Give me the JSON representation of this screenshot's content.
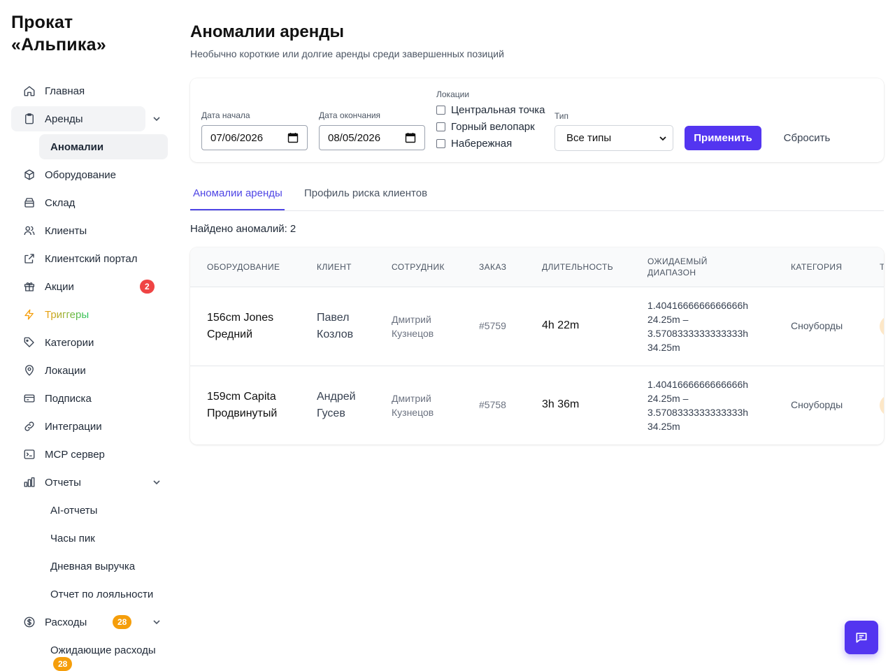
{
  "app": {
    "brand_line1": "Прокат",
    "brand_line2": "«Альпика»"
  },
  "sidebar": {
    "items": [
      {
        "label": "Главная",
        "icon": "home-icon"
      },
      {
        "label": "Аренды",
        "icon": "clipboard-icon"
      },
      {
        "label": "Аномалии"
      },
      {
        "label": "Оборудование",
        "icon": "box-icon"
      },
      {
        "label": "Склад",
        "icon": "warehouse-icon"
      },
      {
        "label": "Клиенты",
        "icon": "users-icon"
      },
      {
        "label": "Клиентский портал",
        "icon": "external-link-icon"
      },
      {
        "label": "Акции",
        "icon": "gift-icon",
        "badge": "2"
      },
      {
        "label": "Триггеры",
        "icon": "lightning-icon"
      },
      {
        "label": "Категории",
        "icon": "tag-icon"
      },
      {
        "label": "Локации",
        "icon": "map-pin-icon"
      },
      {
        "label": "Подписка",
        "icon": "credit-card-icon"
      },
      {
        "label": "Интеграции",
        "icon": "link-icon"
      },
      {
        "label": "MCP сервер",
        "icon": "terminal-icon"
      },
      {
        "label": "Отчеты",
        "icon": "bar-chart-icon"
      },
      {
        "label": "AI-отчеты"
      },
      {
        "label": "Часы пик"
      },
      {
        "label": "Дневная выручка"
      },
      {
        "label": "Отчет по лояльности"
      },
      {
        "label": "Расходы",
        "icon": "dollar-circle-icon",
        "badge": "28"
      },
      {
        "label": "Ожидающие расходы",
        "badge": "28"
      }
    ]
  },
  "page": {
    "title": "Аномалии аренды",
    "subtitle": "Необычно короткие или долгие аренды среди завершенных позиций"
  },
  "filters": {
    "start_label": "Дата начала",
    "start_value": "07/06/2026",
    "end_label": "Дата окончания",
    "end_value": "08/05/2026",
    "locations_label": "Локации",
    "locations": [
      "Центральная точка",
      "Горный велопарк",
      "Набережная"
    ],
    "type_label": "Тип",
    "type_value": "Все типы",
    "apply": "Применить",
    "reset": "Сбросить"
  },
  "tabs": [
    "Аномалии аренды",
    "Профиль риска клиентов"
  ],
  "found": "Найдено аномалий: 2",
  "table": {
    "headers": [
      "ОБОРУДОВАНИЕ",
      "КЛИЕНТ",
      "СОТРУДНИК",
      "ЗАКАЗ",
      "ДЛИТЕЛЬНОСТЬ",
      "ОЖИДАЕМЫЙ ДИАПАЗОН",
      "КАТЕГОРИЯ",
      "Т"
    ],
    "rows": [
      {
        "equipment": "156cm Jones Средний",
        "client": "Павел Козлов",
        "staff": "Дмитрий Кузнецов",
        "order": "#5759",
        "duration": "4h 22m",
        "range": "1.4041666666666666h 24.25m – 3.5708333333333333h 34.25m",
        "category": "Сноуборды"
      },
      {
        "equipment": "159cm Capita Продвинутый",
        "client": "Андрей Гусев",
        "staff": "Дмитрий Кузнецов",
        "order": "#5758",
        "duration": "3h 36m",
        "range": "1.4041666666666666h 24.25m – 3.5708333333333333h 34.25m",
        "category": "Сноуборды"
      }
    ]
  },
  "colors": {
    "accent": "#5335f0",
    "badge_red": "#ef4444",
    "badge_orange": "#f59e0b"
  }
}
